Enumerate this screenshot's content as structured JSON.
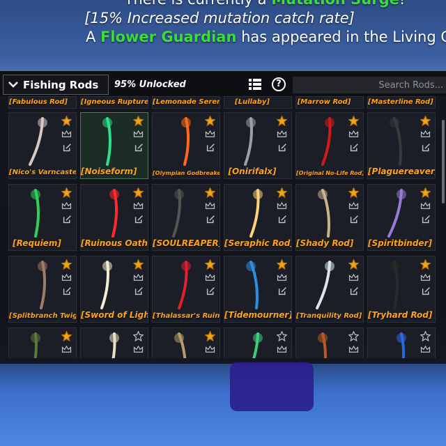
{
  "banner": {
    "line1_prefix": "There is currently a ",
    "line1_highlight": "Mutation Surge",
    "line1_suffix": "!",
    "line2": "[15% Increased mutation catch rate]",
    "line3_prefix": "A ",
    "line3_highlight": "Flower Guardian",
    "line3_suffix": " has appeared in the Living Ga"
  },
  "topbar": {
    "category_label": "Fishing Rods",
    "unlocked_text": "95% Unlocked",
    "search_placeholder": "Search Rods..."
  },
  "top_row": [
    "[Fabulous Rod]",
    "[Igneous Rupturer]",
    "[Lemonade Serenade]",
    "[Lullaby]",
    "[Marrow Rod]",
    "[Masterline Rod]"
  ],
  "rows": [
    [
      {
        "name": "[Nico's Varncaster]",
        "size": "small",
        "color": "#d8c7c7",
        "star": true
      },
      {
        "name": "[Noiseform]",
        "size": "big",
        "color": "#2ee089",
        "star": true,
        "selected": true
      },
      {
        "name": "[Olympian Godbreaker]",
        "size": "tiny",
        "color": "#ff6a1a",
        "star": true
      },
      {
        "name": "[Onirifalx]",
        "size": "big",
        "color": "#9aa0aa",
        "star": true
      },
      {
        "name": "[Original No-Life Rod]",
        "size": "tiny",
        "color": "#d01a1a",
        "star": true
      },
      {
        "name": "[Plaguereaver]",
        "size": "big",
        "color": "#3a3a3a",
        "star": true
      }
    ],
    [
      {
        "name": "[Requiem]",
        "size": "big",
        "color": "#2fd05a",
        "star": true
      },
      {
        "name": "[Ruinous Oath]",
        "size": "big",
        "color": "#ff2a2a",
        "star": true
      },
      {
        "name": "[SOULREAPER]",
        "size": "big",
        "color": "#555",
        "star": true
      },
      {
        "name": "[Seraphic Rod]",
        "size": "big",
        "color": "#ffd27a",
        "star": true
      },
      {
        "name": "[Shady Rod]",
        "size": "big",
        "color": "#c9b38a",
        "star": true
      },
      {
        "name": "[Spiritbinder]",
        "size": "big",
        "color": "#9b7ad6",
        "star": true
      }
    ],
    [
      {
        "name": "[Splitbranch Twig]",
        "size": "small",
        "color": "#a07a6a",
        "star": true
      },
      {
        "name": "[Sword of Light]",
        "size": "big",
        "color": "#f4ecd0",
        "star": true
      },
      {
        "name": "[Thalassar's Ruin]",
        "size": "small",
        "color": "#e0202a",
        "star": true
      },
      {
        "name": "[Tidemourner]",
        "size": "big",
        "color": "#2a8fe0",
        "star": true
      },
      {
        "name": "[Tranquility Rod]",
        "size": "small",
        "color": "#d9e6f0",
        "star": true
      },
      {
        "name": "[Tryhard Rod]",
        "size": "big",
        "color": "#2a2a2a",
        "star": true
      }
    ],
    [
      {
        "name": "",
        "size": "small",
        "color": "#5a7a3a",
        "star": true
      },
      {
        "name": "",
        "size": "small",
        "color": "#e8e0c0",
        "star": false
      },
      {
        "name": "",
        "size": "small",
        "color": "#b89a6a",
        "star": true
      },
      {
        "name": "",
        "size": "small",
        "color": "#3ad07a",
        "star": false
      },
      {
        "name": "",
        "size": "small",
        "color": "#b85a2a",
        "star": false
      },
      {
        "name": "",
        "size": "small",
        "color": "#2a6ae0",
        "star": false
      }
    ]
  ],
  "colors": {
    "accent_name": "#ffa31a",
    "highlight_green": "#3cdc3c",
    "star_gold": "#f2a51a"
  }
}
